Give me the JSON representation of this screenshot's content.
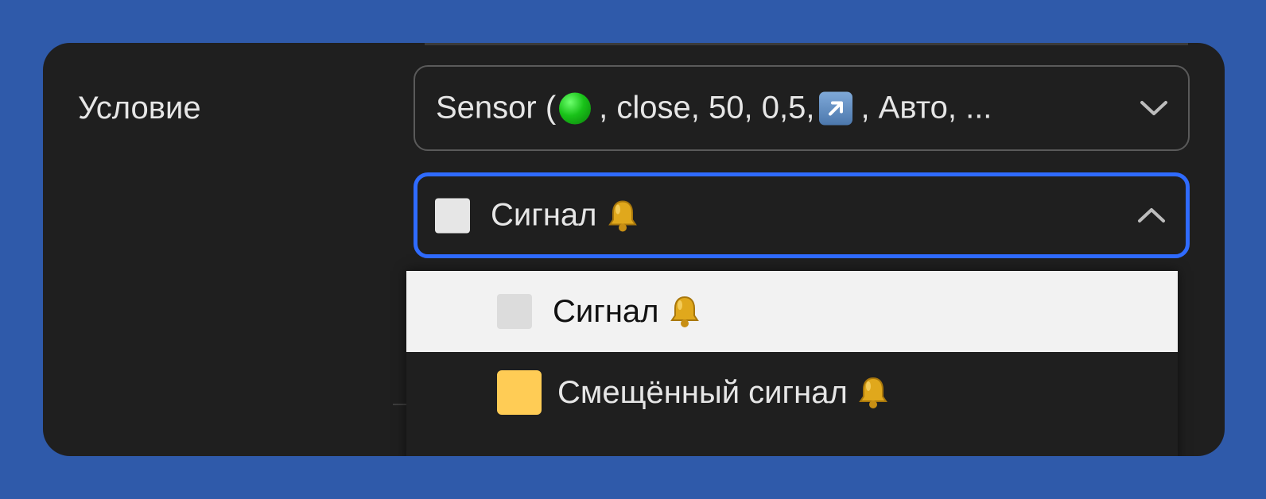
{
  "form": {
    "condition_label": "Условие",
    "condition_select": {
      "value_prefix": "Sensor (",
      "value_middle": ", close, 50, 0,5,",
      "value_suffix": ", Авто, ...",
      "status_dot_color": "#19c219",
      "icon_arrow": "arrow-up-right-icon",
      "chevron": "chevron-down-icon"
    },
    "signal_select": {
      "value": "Сигнал",
      "swatch_color": "#e6e6e6",
      "icon": "bell-icon",
      "chevron": "chevron-up-icon",
      "focus_color": "#2f6bff"
    }
  },
  "dropdown": {
    "options": [
      {
        "label": "Сигнал",
        "swatch_color": "#dcdcdc",
        "icon": "bell-icon",
        "highlighted": true
      },
      {
        "label": "Смещённый сигнал",
        "swatch_color": "#ffcc55",
        "icon": "bell-icon",
        "highlighted": false
      }
    ]
  },
  "colors": {
    "page_background": "#2f5aaa",
    "panel_background": "#1f1f1f",
    "text": "#e6e6e6"
  }
}
